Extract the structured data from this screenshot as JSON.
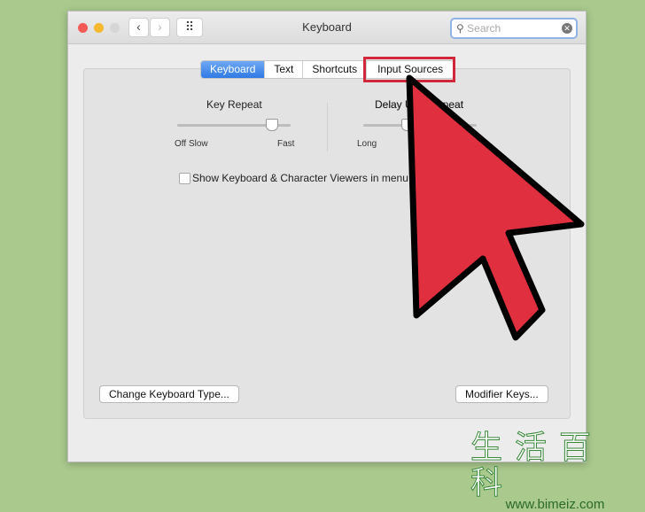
{
  "window": {
    "title": "Keyboard",
    "search_placeholder": "Search",
    "back": "‹",
    "forward": "›",
    "grid": "⠿"
  },
  "tabs": [
    {
      "label": "Keyboard",
      "selected": true
    },
    {
      "label": "Text"
    },
    {
      "label": "Shortcuts"
    },
    {
      "label": "Input Sources",
      "highlighted": true
    }
  ],
  "key_repeat": {
    "label": "Key Repeat",
    "min": "Off",
    "slow": "Slow",
    "max": "Fast",
    "value_percent": 85
  },
  "delay": {
    "label": "Delay Until Repeat",
    "visible_label": "Delay U",
    "visible_label_end": "eat",
    "min": "Long",
    "value_percent": 25
  },
  "checkbox": {
    "label": "Show Keyboard & Character Viewers in menu",
    "checked": false
  },
  "buttons": {
    "change_type": "Change Keyboard Type...",
    "modifier": "Modifier Keys..."
  },
  "watermark": {
    "chinese": "生活百科",
    "url": "www.bimeiz.com"
  },
  "colors": {
    "highlight": "#d0283a",
    "arrow": "#e0303f",
    "accent": "#2f7ae5"
  }
}
